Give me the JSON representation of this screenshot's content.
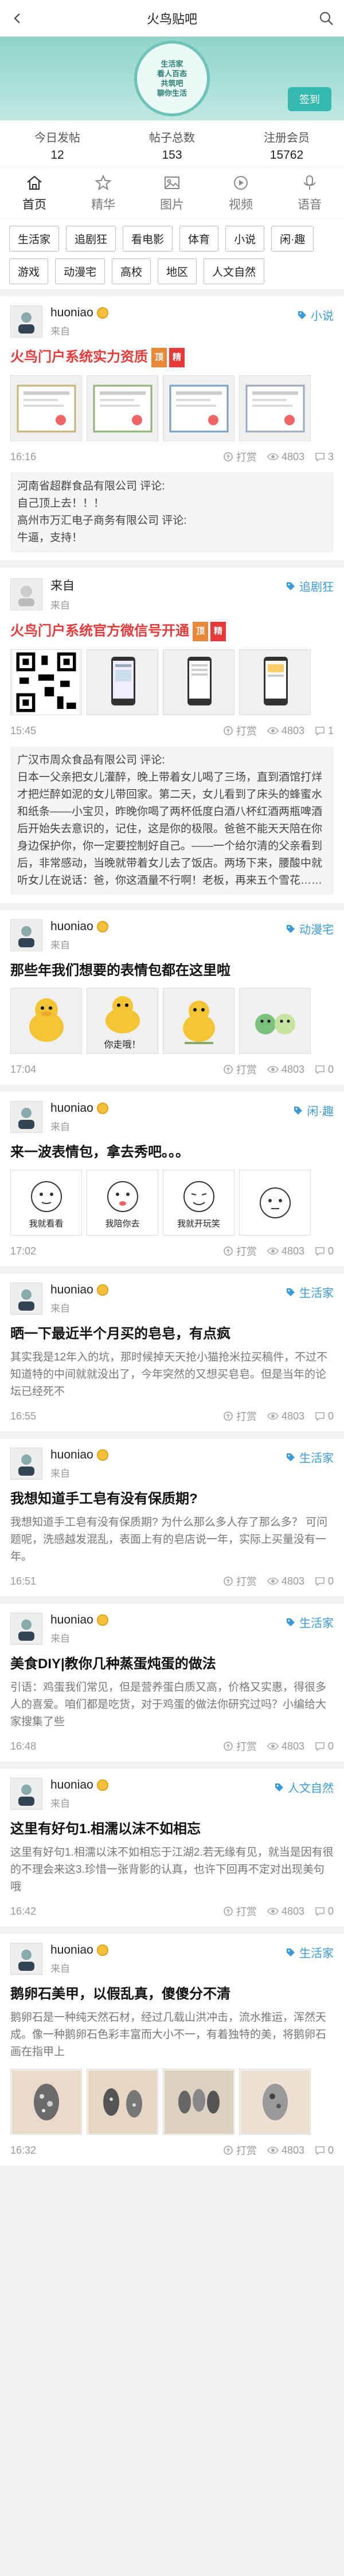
{
  "header": {
    "title": "火鸟贴吧",
    "back_icon": "back-chevron-icon",
    "search_icon": "search-icon"
  },
  "banner": {
    "text_line1": "生活家",
    "text_line2": "看人百态",
    "text_line3": "共筑吧",
    "text_line4": "聊你生活",
    "checkin_label": "签到"
  },
  "stats": [
    {
      "label": "今日发帖",
      "value": "12"
    },
    {
      "label": "帖子总数",
      "value": "153"
    },
    {
      "label": "注册会员",
      "value": "15762"
    }
  ],
  "tabs": [
    {
      "label": "首页",
      "active": true,
      "icon": "home-icon"
    },
    {
      "label": "精华",
      "icon": "star-icon"
    },
    {
      "label": "图片",
      "icon": "image-icon"
    },
    {
      "label": "视频",
      "icon": "video-icon"
    },
    {
      "label": "语音",
      "icon": "voice-icon"
    }
  ],
  "categories": [
    "生活家",
    "追剧狂",
    "看电影",
    "体育",
    "小说",
    "闲·趣",
    "游戏",
    "动漫宅",
    "高校",
    "地区",
    "人文自然"
  ],
  "posts": [
    {
      "user": "huoniao",
      "from": "来自",
      "tag": "小说",
      "title": "火鸟门户系统实力资质",
      "title_color": "red",
      "ding": "顶",
      "jing": "精",
      "time": "16:16",
      "reward": "打赏",
      "views": "4803",
      "comments_count": "3",
      "comment1": "河南省超群食品有限公司  评论:",
      "comment1b": "自己顶上去！！！",
      "comment2": "高州市万汇电子商务有限公司  评论:",
      "comment2b": "牛逼，支持！"
    },
    {
      "user": "来自",
      "from": "来自",
      "tag": "追剧狂",
      "title": "火鸟门户系统官方微信号开通",
      "title_color": "red",
      "ding": "顶",
      "jing": "精",
      "time": "15:45",
      "reward": "打赏",
      "views": "4803",
      "comments_count": "1",
      "comment1": "广汉市周众食品有限公司 评论:",
      "commentLong": "日本一父亲把女儿灌醉，晚上带着女儿喝了三场，直到酒馆打烊才把烂醉如泥的女儿带回家。第二天，女儿看到了床头的蜂蜜水和纸条——小宝贝，昨晚你喝了两杯低度白酒八杯红酒两瓶啤酒后开始失去意识的，记住，这是你的极限。爸爸不能天天陪在你身边保护你，你一定要控制好自己。——一个给尔清的父亲看到后，非常感动，当晚就带着女儿去了饭店。两场下来，腰酸中就听女儿在说话：爸，你这酒量不行啊！老板，再来五个雪花……"
    },
    {
      "user": "huoniao",
      "from": "来自",
      "tag": "动漫宅",
      "title": "那些年我们想要的表情包都在这里啦",
      "time": "17:04",
      "reward": "打赏",
      "views": "4803",
      "comments_count": "0",
      "caption1": "你走哦！"
    },
    {
      "user": "huoniao",
      "from": "来自",
      "tag": "闲·趣",
      "title": "来一波表情包，拿去秀吧。。。",
      "time": "17:02",
      "reward": "打赏",
      "views": "4803",
      "comments_count": "0",
      "captions": [
        "我就看看",
        "我陪你去",
        "我就开玩笑"
      ]
    },
    {
      "user": "huoniao",
      "from": "来自",
      "tag": "生活家",
      "title": "晒一下最近半个月买的皂皂，有点疯",
      "body": "其实我是12年入的坑，那时候掉天天抢小猫抢米拉买稿件，不过不知道特的中间就就没出了，今年突然的又想买皂皂。但是当年的论坛已经死不",
      "time": "16:55",
      "reward": "打赏",
      "views": "4803",
      "comments_count": "0"
    },
    {
      "user": "huoniao",
      "from": "来自",
      "tag": "生活家",
      "title": "我想知道手工皂有没有保质期?",
      "body": "我想知道手工皂有没有保质期? 为什么那么多人存了那么多？ 可问题呢，洗感越发混乱，表面上有的皂店说一年，实际上买量没有一年。",
      "time": "16:51",
      "reward": "打赏",
      "views": "4803",
      "comments_count": "0"
    },
    {
      "user": "huoniao",
      "from": "来自",
      "tag": "生活家",
      "title": "美食DIY|教你几种蒸蛋炖蛋的做法",
      "body": "引语：鸡蛋我们常见，但是营养蛋白质又高，价格又实惠，得很多人的喜爱。咱们都是吃货，对于鸡蛋的做法你研究过吗？小编给大家搜集了些",
      "time": "16:48",
      "reward": "打赏",
      "views": "4803",
      "comments_count": "0"
    },
    {
      "user": "huoniao",
      "from": "来自",
      "tag": "人文自然",
      "title": "这里有好句1.相濡以沫不如相忘",
      "body": "这里有好句1.相濡以沫不如相忘于江湖2.若无缘有见，就当是因有很的不理会来这3.珍惜一张背影的认真，也许下回再不定对出现美句哦",
      "time": "16:42",
      "reward": "打赏",
      "views": "4803",
      "comments_count": "0"
    },
    {
      "user": "huoniao",
      "from": "来自",
      "tag": "生活家",
      "title": "鹅卵石美甲，以假乱真，傻傻分不清",
      "body": "鹅卵石是一种纯天然石材，经过几载山洪冲击，流水推运，浑然天成。像一种鹅卵石色彩丰富而大小不一，有着独特的美，将鹅卵石画在指甲上",
      "time": "16:32",
      "reward": "打赏",
      "views": "4803",
      "comments_count": "0"
    }
  ]
}
